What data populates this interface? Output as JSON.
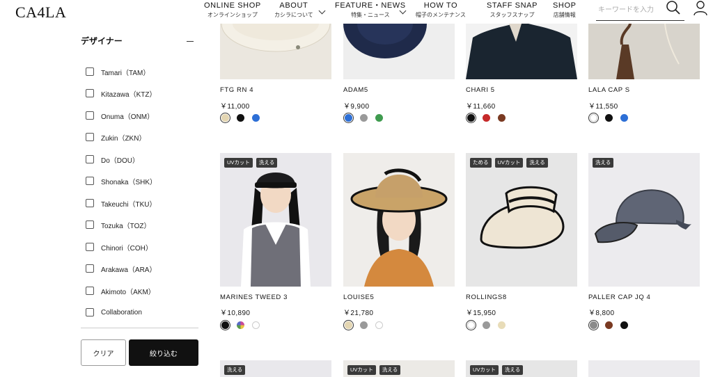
{
  "header": {
    "logo": "CA4LA",
    "nav": [
      {
        "en": "ONLINE SHOP",
        "jp": "オンラインショップ"
      },
      {
        "en": "ABOUT",
        "jp": "カシラについて"
      },
      {
        "en": "FEATURE・NEWS",
        "jp": "特集・ニュース"
      },
      {
        "en": "HOW TO",
        "jp": "帽子のメンテナンス"
      },
      {
        "en": "STAFF SNAP",
        "jp": "スタッフスナップ"
      },
      {
        "en": "SHOP",
        "jp": "店舗情報"
      }
    ],
    "search_placeholder": "キーワードを入力"
  },
  "sidebar": {
    "title": "デザイナー",
    "items": [
      {
        "label": "Tamari（TAM）"
      },
      {
        "label": "Kitazawa（KTZ）"
      },
      {
        "label": "Onuma（ONM）"
      },
      {
        "label": "Zukin（ZKN）"
      },
      {
        "label": "Do（DOU）"
      },
      {
        "label": "Shonaka（SHK）"
      },
      {
        "label": "Takeuchi（TKU）"
      },
      {
        "label": "Tozuka（TOZ）"
      },
      {
        "label": "Chinori（COH）"
      },
      {
        "label": "Arakawa（ARA）"
      },
      {
        "label": "Akimoto（AKM）"
      },
      {
        "label": "Collaboration"
      }
    ],
    "clear_label": "クリア",
    "apply_label": "絞り込む"
  },
  "products_row1": [
    {
      "name": "FTG RN 4",
      "price": "￥11,000",
      "swatches": [
        "#e4d6b2",
        "#111111",
        "#2d6fd6"
      ],
      "selected": 0
    },
    {
      "name": "ADAM5",
      "price": "￥9,900",
      "swatches": [
        "#2d6fd6",
        "#9a9a9a",
        "#3f9b4f"
      ],
      "selected": 0
    },
    {
      "name": "CHARI 5",
      "price": "￥11,660",
      "swatches": [
        "#111111",
        "#c62a2a",
        "#7a3a22"
      ],
      "selected": 0
    },
    {
      "name": "LALA CAP S",
      "price": "￥11,550",
      "swatches": [
        "#ffffff",
        "#111111",
        "#2d6fd6"
      ],
      "selected": 0
    }
  ],
  "products_row2": [
    {
      "name": "MARINES TWEED 3",
      "price": "￥10,890",
      "badges": [
        "UVカット",
        "洗える"
      ],
      "swatches": [
        "#111111",
        "multi",
        "#ffffff"
      ],
      "selected": 0
    },
    {
      "name": "LOUISE5",
      "price": "￥21,780",
      "badges": [],
      "swatches": [
        "#e4d6b2",
        "#9a9a9a",
        "#ffffff"
      ],
      "selected": 0
    },
    {
      "name": "ROLLINGS8",
      "price": "￥15,950",
      "badges": [
        "ためる",
        "UVカット",
        "洗える"
      ],
      "swatches": [
        "#ffffff",
        "#9a9a9a",
        "#e8dcb8"
      ],
      "selected": 0
    },
    {
      "name": "PALLER CAP JQ 4",
      "price": "￥8,800",
      "badges": [
        "洗える"
      ],
      "swatches": [
        "#8a8a8a",
        "#7a3a22",
        "#111111"
      ],
      "selected": 0
    }
  ],
  "products_row3": [
    {
      "badges": [
        "洗える"
      ]
    },
    {
      "badges": [
        "UVカット",
        "洗える"
      ]
    },
    {
      "badges": [
        "UVカット",
        "洗える"
      ]
    },
    {
      "badges": []
    }
  ]
}
